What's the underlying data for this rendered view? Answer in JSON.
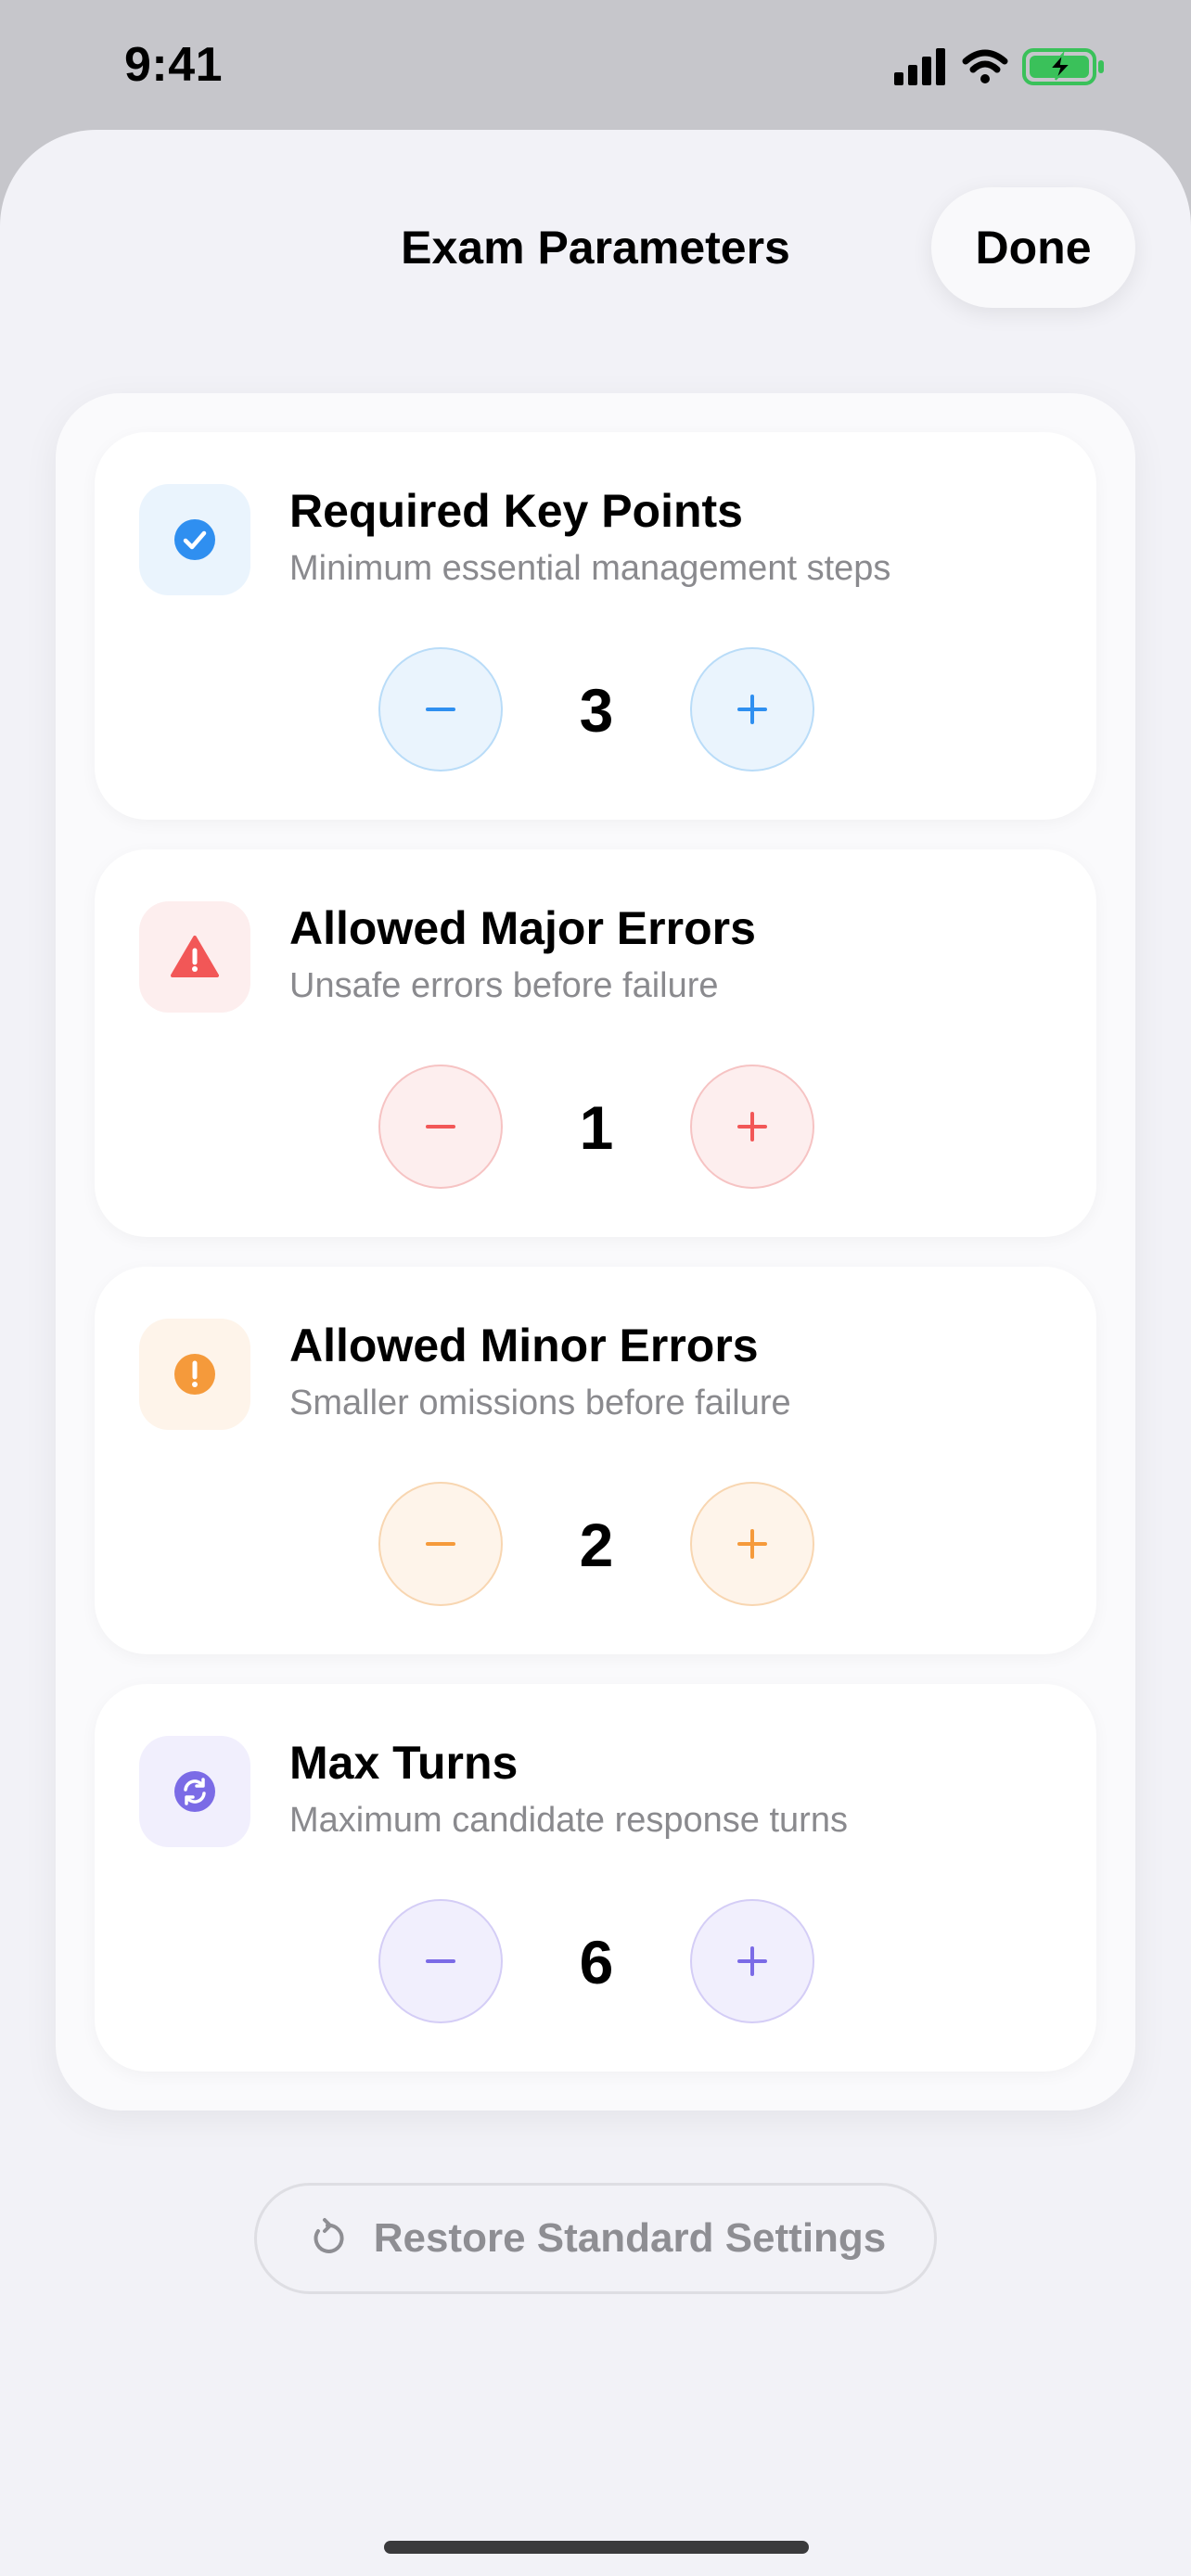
{
  "status": {
    "time": "9:41"
  },
  "nav": {
    "title": "Exam Parameters",
    "done_label": "Done"
  },
  "cards": [
    {
      "title": "Required Key Points",
      "subtitle": "Minimum essential management steps",
      "value": "3",
      "icon": "checkmark-circle-icon",
      "accent": "#2f8ff0",
      "tint": "#eaf4fd",
      "border": "#b9dcf8"
    },
    {
      "title": "Allowed Major Errors",
      "subtitle": "Unsafe errors before failure",
      "value": "1",
      "icon": "warning-triangle-icon",
      "accent": "#f25757",
      "tint": "#fdeeee",
      "border": "#f6c3c3"
    },
    {
      "title": "Allowed Minor Errors",
      "subtitle": "Smaller omissions before failure",
      "value": "2",
      "icon": "exclamation-circle-icon",
      "accent": "#f59a3b",
      "tint": "#fef4ea",
      "border": "#f8d6b1"
    },
    {
      "title": "Max Turns",
      "subtitle": "Maximum candidate response turns",
      "value": "6",
      "icon": "refresh-circle-icon",
      "accent": "#7b6be6",
      "tint": "#f1effd",
      "border": "#d4cdf6"
    }
  ],
  "restore": {
    "label": "Restore Standard Settings",
    "icon": "restore-arrow-icon"
  }
}
